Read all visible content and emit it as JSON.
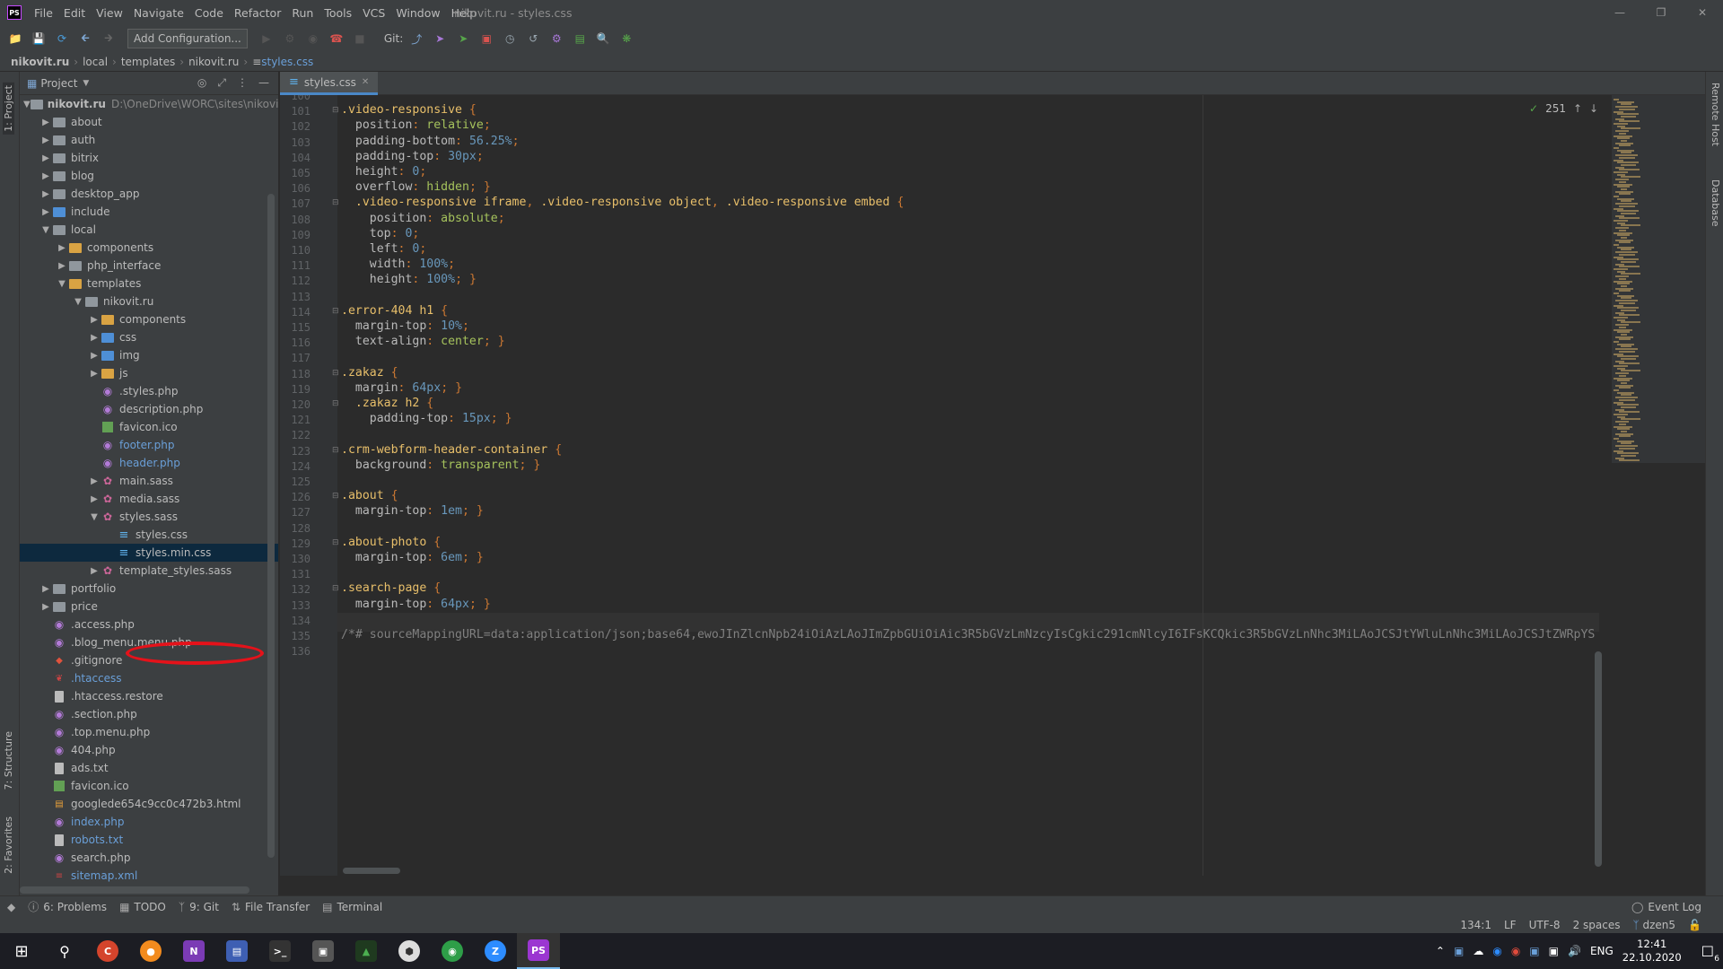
{
  "window": {
    "title": "nikovit.ru - styles.css",
    "logo": "PS",
    "menu": [
      "File",
      "Edit",
      "View",
      "Navigate",
      "Code",
      "Refactor",
      "Run",
      "Tools",
      "VCS",
      "Window",
      "Help"
    ]
  },
  "toolbar": {
    "add_configuration": "Add Configuration...",
    "git_label": "Git:"
  },
  "breadcrumbs": [
    "nikovit.ru",
    "local",
    "templates",
    "nikovit.ru",
    "styles.css"
  ],
  "project_panel": {
    "title": "Project",
    "root_name": "nikovit.ru",
    "root_path": "D:\\OneDrive\\WORC\\sites\\nikovit.ru"
  },
  "tree": [
    {
      "name": "about",
      "indent": 1,
      "arrow": "collapsed",
      "icon": "folder"
    },
    {
      "name": "auth",
      "indent": 1,
      "arrow": "collapsed",
      "icon": "folder"
    },
    {
      "name": "bitrix",
      "indent": 1,
      "arrow": "collapsed",
      "icon": "folder"
    },
    {
      "name": "blog",
      "indent": 1,
      "arrow": "collapsed",
      "icon": "folder"
    },
    {
      "name": "desktop_app",
      "indent": 1,
      "arrow": "collapsed",
      "icon": "folder"
    },
    {
      "name": "include",
      "indent": 1,
      "arrow": "collapsed",
      "icon": "folder-blue"
    },
    {
      "name": "local",
      "indent": 1,
      "arrow": "expanded",
      "icon": "folder"
    },
    {
      "name": "components",
      "indent": 2,
      "arrow": "collapsed",
      "icon": "folder-yellow"
    },
    {
      "name": "php_interface",
      "indent": 2,
      "arrow": "collapsed",
      "icon": "folder"
    },
    {
      "name": "templates",
      "indent": 2,
      "arrow": "expanded",
      "icon": "folder-yellow"
    },
    {
      "name": "nikovit.ru",
      "indent": 3,
      "arrow": "expanded",
      "icon": "folder"
    },
    {
      "name": "components",
      "indent": 4,
      "arrow": "collapsed",
      "icon": "folder-yellow"
    },
    {
      "name": "css",
      "indent": 4,
      "arrow": "collapsed",
      "icon": "folder-blue"
    },
    {
      "name": "img",
      "indent": 4,
      "arrow": "collapsed",
      "icon": "folder-blue"
    },
    {
      "name": "js",
      "indent": 4,
      "arrow": "collapsed",
      "icon": "folder-yellow"
    },
    {
      "name": ".styles.php",
      "indent": 4,
      "arrow": "none",
      "icon": "php"
    },
    {
      "name": "description.php",
      "indent": 4,
      "arrow": "none",
      "icon": "php"
    },
    {
      "name": "favicon.ico",
      "indent": 4,
      "arrow": "none",
      "icon": "image"
    },
    {
      "name": "footer.php",
      "indent": 4,
      "arrow": "none",
      "icon": "php",
      "color": "#6a9fd8"
    },
    {
      "name": "header.php",
      "indent": 4,
      "arrow": "none",
      "icon": "php",
      "color": "#6a9fd8"
    },
    {
      "name": "main.sass",
      "indent": 4,
      "arrow": "collapsed",
      "icon": "sass"
    },
    {
      "name": "media.sass",
      "indent": 4,
      "arrow": "collapsed",
      "icon": "sass"
    },
    {
      "name": "styles.sass",
      "indent": 4,
      "arrow": "expanded",
      "icon": "sass"
    },
    {
      "name": "styles.css",
      "indent": 5,
      "arrow": "none",
      "icon": "css"
    },
    {
      "name": "styles.min.css",
      "indent": 5,
      "arrow": "none",
      "icon": "css",
      "selected": true
    },
    {
      "name": "template_styles.sass",
      "indent": 4,
      "arrow": "collapsed",
      "icon": "sass"
    },
    {
      "name": "portfolio",
      "indent": 1,
      "arrow": "collapsed",
      "icon": "folder"
    },
    {
      "name": "price",
      "indent": 1,
      "arrow": "collapsed",
      "icon": "folder"
    },
    {
      "name": ".access.php",
      "indent": 1,
      "arrow": "none",
      "icon": "php"
    },
    {
      "name": ".blog_menu.menu.php",
      "indent": 1,
      "arrow": "none",
      "icon": "php"
    },
    {
      "name": ".gitignore",
      "indent": 1,
      "arrow": "none",
      "icon": "git"
    },
    {
      "name": ".htaccess",
      "indent": 1,
      "arrow": "none",
      "icon": "htaccess",
      "color": "#6a9fd8"
    },
    {
      "name": ".htaccess.restore",
      "indent": 1,
      "arrow": "none",
      "icon": "text"
    },
    {
      "name": ".section.php",
      "indent": 1,
      "arrow": "none",
      "icon": "php"
    },
    {
      "name": ".top.menu.php",
      "indent": 1,
      "arrow": "none",
      "icon": "php"
    },
    {
      "name": "404.php",
      "indent": 1,
      "arrow": "none",
      "icon": "php"
    },
    {
      "name": "ads.txt",
      "indent": 1,
      "arrow": "none",
      "icon": "text"
    },
    {
      "name": "favicon.ico",
      "indent": 1,
      "arrow": "none",
      "icon": "image"
    },
    {
      "name": "googlede654c9cc0c472b3.html",
      "indent": 1,
      "arrow": "none",
      "icon": "html"
    },
    {
      "name": "index.php",
      "indent": 1,
      "arrow": "none",
      "icon": "php",
      "color": "#6a9fd8"
    },
    {
      "name": "robots.txt",
      "indent": 1,
      "arrow": "none",
      "icon": "text",
      "color": "#6a9fd8"
    },
    {
      "name": "search.php",
      "indent": 1,
      "arrow": "none",
      "icon": "php"
    },
    {
      "name": "sitemap.xml",
      "indent": 1,
      "arrow": "none",
      "icon": "xml",
      "color": "#6a9fd8"
    }
  ],
  "editor": {
    "tab": "styles.css",
    "hits": "251",
    "current_line": 134,
    "lines": [
      {
        "n": "100",
        "c": []
      },
      {
        "n": "101",
        "c": [
          [
            "sel",
            ".video-responsive "
          ],
          [
            "pun",
            "{"
          ]
        ]
      },
      {
        "n": "102",
        "c": [
          [
            "prop",
            "  position"
          ],
          [
            "pun",
            ": "
          ],
          [
            "val",
            "relative"
          ],
          [
            "pun",
            ";"
          ]
        ]
      },
      {
        "n": "103",
        "c": [
          [
            "prop",
            "  padding-bottom"
          ],
          [
            "pun",
            ": "
          ],
          [
            "num",
            "56.25%"
          ],
          [
            "pun",
            ";"
          ]
        ]
      },
      {
        "n": "104",
        "c": [
          [
            "prop",
            "  padding-top"
          ],
          [
            "pun",
            ": "
          ],
          [
            "num",
            "30px"
          ],
          [
            "pun",
            ";"
          ]
        ]
      },
      {
        "n": "105",
        "c": [
          [
            "prop",
            "  height"
          ],
          [
            "pun",
            ": "
          ],
          [
            "num",
            "0"
          ],
          [
            "pun",
            ";"
          ]
        ]
      },
      {
        "n": "106",
        "c": [
          [
            "prop",
            "  overflow"
          ],
          [
            "pun",
            ": "
          ],
          [
            "val",
            "hidden"
          ],
          [
            "pun",
            "; }"
          ]
        ]
      },
      {
        "n": "107",
        "c": [
          [
            "sel",
            "  .video-responsive iframe"
          ],
          [
            "pun",
            ", "
          ],
          [
            "sel",
            ".video-responsive object"
          ],
          [
            "pun",
            ", "
          ],
          [
            "sel",
            ".video-responsive embed "
          ],
          [
            "pun",
            "{"
          ]
        ]
      },
      {
        "n": "108",
        "c": [
          [
            "prop",
            "    position"
          ],
          [
            "pun",
            ": "
          ],
          [
            "val",
            "absolute"
          ],
          [
            "pun",
            ";"
          ]
        ]
      },
      {
        "n": "109",
        "c": [
          [
            "prop",
            "    top"
          ],
          [
            "pun",
            ": "
          ],
          [
            "num",
            "0"
          ],
          [
            "pun",
            ";"
          ]
        ]
      },
      {
        "n": "110",
        "c": [
          [
            "prop",
            "    left"
          ],
          [
            "pun",
            ": "
          ],
          [
            "num",
            "0"
          ],
          [
            "pun",
            ";"
          ]
        ]
      },
      {
        "n": "111",
        "c": [
          [
            "prop",
            "    width"
          ],
          [
            "pun",
            ": "
          ],
          [
            "num",
            "100%"
          ],
          [
            "pun",
            ";"
          ]
        ]
      },
      {
        "n": "112",
        "c": [
          [
            "prop",
            "    height"
          ],
          [
            "pun",
            ": "
          ],
          [
            "num",
            "100%"
          ],
          [
            "pun",
            "; }"
          ]
        ]
      },
      {
        "n": "113",
        "c": []
      },
      {
        "n": "114",
        "c": [
          [
            "sel",
            ".error-404 h1 "
          ],
          [
            "pun",
            "{"
          ]
        ]
      },
      {
        "n": "115",
        "c": [
          [
            "prop",
            "  margin-top"
          ],
          [
            "pun",
            ": "
          ],
          [
            "num",
            "10%"
          ],
          [
            "pun",
            ";"
          ]
        ]
      },
      {
        "n": "116",
        "c": [
          [
            "prop",
            "  text-align"
          ],
          [
            "pun",
            ": "
          ],
          [
            "val",
            "center"
          ],
          [
            "pun",
            "; }"
          ]
        ]
      },
      {
        "n": "117",
        "c": []
      },
      {
        "n": "118",
        "c": [
          [
            "sel",
            ".zakaz "
          ],
          [
            "pun",
            "{"
          ]
        ]
      },
      {
        "n": "119",
        "c": [
          [
            "prop",
            "  margin"
          ],
          [
            "pun",
            ": "
          ],
          [
            "num",
            "64px"
          ],
          [
            "pun",
            "; }"
          ]
        ]
      },
      {
        "n": "120",
        "c": [
          [
            "sel",
            "  .zakaz h2 "
          ],
          [
            "pun",
            "{"
          ]
        ]
      },
      {
        "n": "121",
        "c": [
          [
            "prop",
            "    padding-top"
          ],
          [
            "pun",
            ": "
          ],
          [
            "num",
            "15px"
          ],
          [
            "pun",
            "; }"
          ]
        ]
      },
      {
        "n": "122",
        "c": []
      },
      {
        "n": "123",
        "c": [
          [
            "sel",
            ".crm-webform-header-container "
          ],
          [
            "pun",
            "{"
          ]
        ]
      },
      {
        "n": "124",
        "c": [
          [
            "prop",
            "  background"
          ],
          [
            "pun",
            ": "
          ],
          [
            "val",
            "transparent"
          ],
          [
            "pun",
            "; }"
          ]
        ]
      },
      {
        "n": "125",
        "c": []
      },
      {
        "n": "126",
        "c": [
          [
            "sel",
            ".about "
          ],
          [
            "pun",
            "{"
          ]
        ]
      },
      {
        "n": "127",
        "c": [
          [
            "prop",
            "  margin-top"
          ],
          [
            "pun",
            ": "
          ],
          [
            "num",
            "1em"
          ],
          [
            "pun",
            "; }"
          ]
        ]
      },
      {
        "n": "128",
        "c": []
      },
      {
        "n": "129",
        "c": [
          [
            "sel",
            ".about-photo "
          ],
          [
            "pun",
            "{"
          ]
        ]
      },
      {
        "n": "130",
        "c": [
          [
            "prop",
            "  margin-top"
          ],
          [
            "pun",
            ": "
          ],
          [
            "num",
            "6em"
          ],
          [
            "pun",
            "; }"
          ]
        ]
      },
      {
        "n": "131",
        "c": []
      },
      {
        "n": "132",
        "c": [
          [
            "sel",
            ".search-page "
          ],
          [
            "pun",
            "{"
          ]
        ]
      },
      {
        "n": "133",
        "c": [
          [
            "prop",
            "  margin-top"
          ],
          [
            "pun",
            ": "
          ],
          [
            "num",
            "64px"
          ],
          [
            "pun",
            "; }"
          ]
        ]
      },
      {
        "n": "134",
        "c": []
      },
      {
        "n": "135",
        "c": [
          [
            "cmt",
            "/*# sourceMappingURL=data:application/json;base64,ewoJInZlcnNpb24iOiAzLAoJImZpbGUiOiAic3R5bGVzLmNzcyIsCgkic291cmNlcyI6IFsKCQkic3R5bGVzLnNhc3MiLAoJCSJtYWluLnNhc3MiLAoJCSJtZWRpYS"
          ]
        ]
      },
      {
        "n": "136",
        "c": []
      }
    ]
  },
  "right_tools": [
    "Remote Host",
    "Database"
  ],
  "left_tools": [
    "1: Project",
    "7: Structure",
    "2: Favorites"
  ],
  "tool_windows": [
    {
      "label": "6: Problems",
      "icon": "info-icon"
    },
    {
      "label": "TODO",
      "icon": "todo-icon"
    },
    {
      "label": "9: Git",
      "icon": "git-branch-icon"
    },
    {
      "label": "File Transfer",
      "icon": "transfer-icon"
    },
    {
      "label": "Terminal",
      "icon": "terminal-icon"
    }
  ],
  "event_log": "Event Log",
  "status": {
    "position": "134:1",
    "line_sep": "LF",
    "encoding": "UTF-8",
    "indent": "2 spaces",
    "branch": "dzen5"
  },
  "taskbar": {
    "lang": "ENG",
    "time": "12:41",
    "date": "22.10.2020",
    "notifications": "6"
  }
}
